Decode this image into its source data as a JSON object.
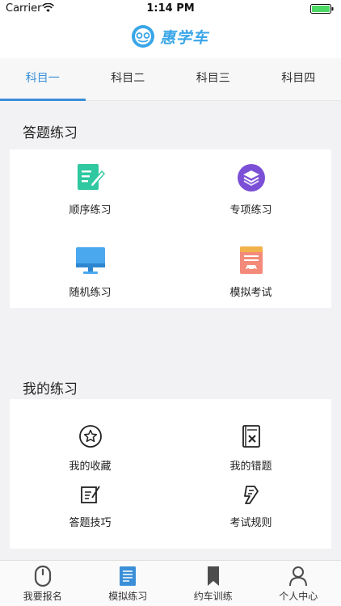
{
  "status_bar": {
    "carrier": "Carrier",
    "time": "1:14 PM"
  },
  "header": {
    "logo_text": "惠学车"
  },
  "tabs": [
    {
      "label": "科目一",
      "active": true
    },
    {
      "label": "科目二",
      "active": false
    },
    {
      "label": "科目三",
      "active": false
    },
    {
      "label": "科目四",
      "active": false
    }
  ],
  "practice": {
    "title": "答题练习",
    "items": [
      {
        "label": "顺序练习",
        "icon": "edit-document-icon"
      },
      {
        "label": "专项练习",
        "icon": "layers-icon"
      },
      {
        "label": "随机练习",
        "icon": "monitor-icon"
      },
      {
        "label": "模拟考试",
        "icon": "exam-paper-icon"
      }
    ]
  },
  "my_practice": {
    "title": "我的练习",
    "items": [
      {
        "label": "我的收藏",
        "icon": "star-icon"
      },
      {
        "label": "我的错题",
        "icon": "wrong-question-icon"
      },
      {
        "label": "答题技巧",
        "icon": "tips-icon"
      },
      {
        "label": "考试规则",
        "icon": "rules-icon"
      }
    ]
  },
  "tab_bar": [
    {
      "label": "我要报名",
      "icon": "mouse-icon",
      "active": false
    },
    {
      "label": "模拟练习",
      "icon": "document-icon",
      "active": true
    },
    {
      "label": "约车训练",
      "icon": "bookmark-icon",
      "active": false
    },
    {
      "label": "个人中心",
      "icon": "person-icon",
      "active": false
    }
  ],
  "colors": {
    "accent": "#3b8fd8",
    "logo": "#3aa6e8"
  }
}
